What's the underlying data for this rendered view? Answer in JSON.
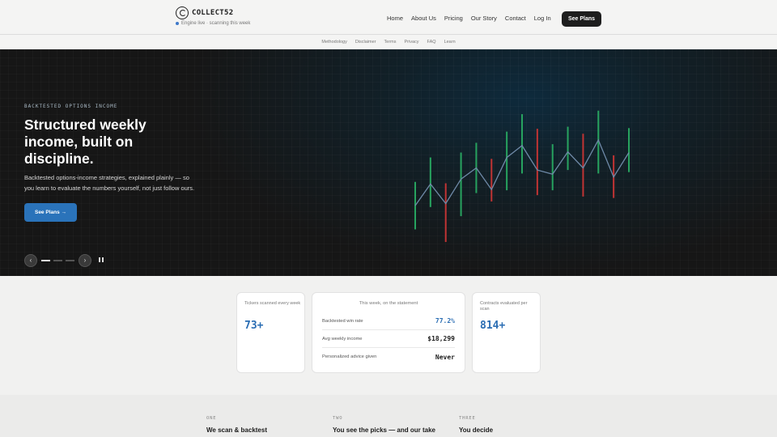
{
  "header": {
    "brand": "COLLECT52",
    "status": "Engine live · scanning this week",
    "nav": [
      "Home",
      "About Us",
      "Pricing",
      "Our Story",
      "Contact",
      "Log In"
    ],
    "cta": "See Plans"
  },
  "subnav": [
    "Methodology",
    "Disclaimer",
    "Terms",
    "Privacy",
    "FAQ",
    "Learn"
  ],
  "hero": {
    "eyebrow": "BACKTESTED OPTIONS INCOME",
    "title": "Structured weekly income, built on discipline.",
    "subtitle": "Backtested options-income strategies, explained plainly — so you learn to evaluate the numbers yourself, not just follow ours.",
    "cta": "See Plans →",
    "carousel": {
      "prev": "‹",
      "next": "›",
      "slides": 3,
      "active": 0
    }
  },
  "chart_data": {
    "type": "candlestick",
    "candles": [
      {
        "low": 18,
        "high": 86,
        "close": 52,
        "dir": "up"
      },
      {
        "low": 50,
        "high": 121,
        "close": 83,
        "dir": "up"
      },
      {
        "low": 0,
        "high": 84,
        "close": 55,
        "dir": "down"
      },
      {
        "low": 37,
        "high": 128,
        "close": 90,
        "dir": "up"
      },
      {
        "low": 70,
        "high": 142,
        "close": 106,
        "dir": "up"
      },
      {
        "low": 58,
        "high": 119,
        "close": 75,
        "dir": "down"
      },
      {
        "low": 74,
        "high": 158,
        "close": 121,
        "dir": "up"
      },
      {
        "low": 98,
        "high": 183,
        "close": 138,
        "dir": "up"
      },
      {
        "low": 67,
        "high": 162,
        "close": 103,
        "dir": "down"
      },
      {
        "low": 74,
        "high": 140,
        "close": 97,
        "dir": "up"
      },
      {
        "low": 103,
        "high": 165,
        "close": 129,
        "dir": "up"
      },
      {
        "low": 65,
        "high": 155,
        "close": 106,
        "dir": "down"
      },
      {
        "low": 98,
        "high": 188,
        "close": 146,
        "dir": "up"
      },
      {
        "low": 63,
        "high": 124,
        "close": 93,
        "dir": "down"
      },
      {
        "low": 100,
        "high": 163,
        "close": 128,
        "dir": "up"
      }
    ],
    "colors": {
      "up": "#27a35f",
      "down": "#c13434",
      "line": "#6f8aa8"
    }
  },
  "stats": {
    "tickers": {
      "label": "Tickers scanned every week",
      "value": "73+"
    },
    "contracts": {
      "label": "Contracts evaluated per scan",
      "value": "814+"
    },
    "statement": {
      "title": "This week, on the statement",
      "rows": [
        {
          "label": "Backtested win rate",
          "value": "77.2%"
        },
        {
          "label": "Avg weekly income",
          "value": "$18,299"
        },
        {
          "label": "Personalized advice given",
          "value": "Never"
        }
      ]
    }
  },
  "steps": [
    {
      "num": "ONE",
      "title": "We scan & backtest"
    },
    {
      "num": "TWO",
      "title": "You see the picks — and our take"
    },
    {
      "num": "THREE",
      "title": "You decide"
    }
  ]
}
